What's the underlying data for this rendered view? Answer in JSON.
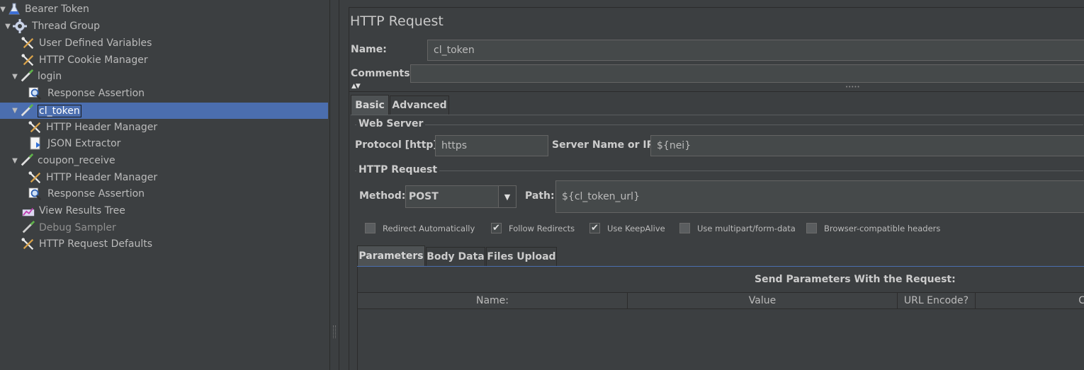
{
  "tree": {
    "items": [
      {
        "label": "Bearer Token",
        "icon": "flask-icon",
        "level": 0,
        "expanded": true
      },
      {
        "label": "Thread Group",
        "icon": "gear-icon",
        "level": 1,
        "expanded": true
      },
      {
        "label": "User Defined Variables",
        "icon": "wrench-icon",
        "level": 2
      },
      {
        "label": "HTTP Cookie Manager",
        "icon": "wrench-icon",
        "level": 2
      },
      {
        "label": "login",
        "icon": "pipette-icon",
        "level": 2,
        "expanded": true
      },
      {
        "label": "Response Assertion",
        "icon": "magnifier-icon",
        "level": 3
      },
      {
        "label": "cl_token",
        "icon": "pipette-icon",
        "level": 2,
        "expanded": true,
        "selected": true
      },
      {
        "label": "HTTP Header Manager",
        "icon": "wrench-icon",
        "level": 3
      },
      {
        "label": "JSON Extractor",
        "icon": "document-icon",
        "level": 3
      },
      {
        "label": "coupon_receive",
        "icon": "pipette-icon",
        "level": 2,
        "expanded": true
      },
      {
        "label": "HTTP Header Manager",
        "icon": "wrench-icon",
        "level": 3
      },
      {
        "label": "Response Assertion",
        "icon": "magnifier-icon",
        "level": 3
      },
      {
        "label": "View Results Tree",
        "icon": "chart-icon",
        "level": 2
      },
      {
        "label": "Debug Sampler",
        "icon": "pipette-icon",
        "level": 2,
        "disabled": true
      },
      {
        "label": "HTTP Request Defaults",
        "icon": "wrench-icon",
        "level": 2
      }
    ]
  },
  "panel": {
    "title": "HTTP Request",
    "name_label": "Name:",
    "name_value": "cl_token",
    "comments_label": "Comments:",
    "comments_value": "",
    "tabs": [
      "Basic",
      "Advanced"
    ],
    "web_server": {
      "group_title": "Web Server",
      "protocol_label": "Protocol [http]:",
      "protocol_value": "https",
      "server_label": "Server Name or IP:",
      "server_value": "${nei}"
    },
    "http_request": {
      "group_title": "HTTP Request",
      "method_label": "Method:",
      "method_value": "POST",
      "path_label": "Path:",
      "path_value": "${cl_token_url}"
    },
    "options": [
      {
        "label": "Redirect Automatically",
        "checked": false
      },
      {
        "label": "Follow Redirects",
        "checked": true
      },
      {
        "label": "Use KeepAlive",
        "checked": true
      },
      {
        "label": "Use multipart/form-data",
        "checked": false
      },
      {
        "label": "Browser-compatible headers",
        "checked": false
      }
    ],
    "sub_tabs": [
      "Parameters",
      "Body Data",
      "Files Upload"
    ],
    "params_title": "Send Parameters With the Request:",
    "columns": [
      "Name:",
      "Value",
      "URL Encode?",
      "C"
    ]
  }
}
